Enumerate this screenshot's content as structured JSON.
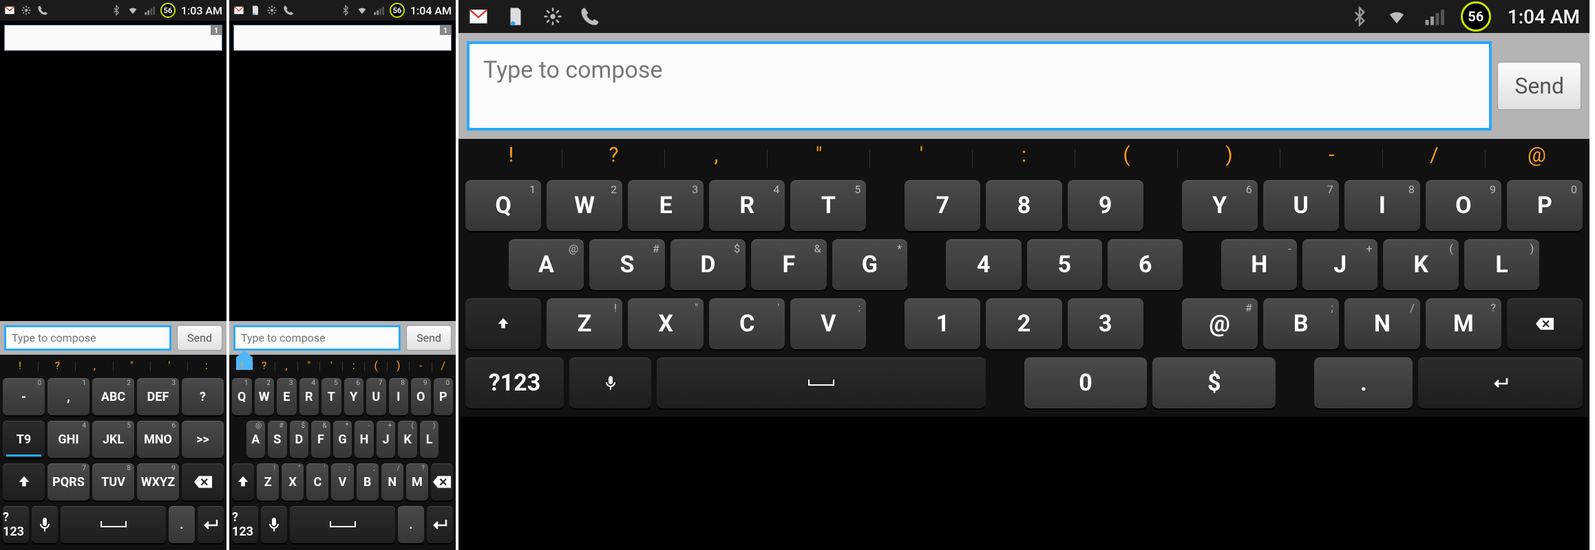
{
  "status": {
    "battery": "56",
    "time1": "1:03 AM",
    "time2": "1:04 AM",
    "time3": "1:04 AM"
  },
  "compose": {
    "placeholder": "Type to compose",
    "send": "Send",
    "recipient_badge": "1"
  },
  "hints_s1": [
    "!",
    "?",
    ",",
    "\"",
    "'",
    ":"
  ],
  "hints_s2": [
    "!",
    "?",
    ",",
    "\"",
    "'",
    ":",
    "(",
    ")",
    "-",
    "/"
  ],
  "hints_s3": [
    "!",
    "?",
    ",",
    "\"",
    "'",
    ":",
    "(",
    ")",
    "-",
    "/",
    "@"
  ],
  "t9": {
    "row1": [
      {
        "main": "-",
        "sup": "0"
      },
      {
        "main": ",",
        "sup": "1"
      },
      {
        "main": "ABC",
        "sup": "2"
      },
      {
        "main": "DEF",
        "sup": "3"
      },
      {
        "main": "?",
        "sup": ""
      }
    ],
    "row2": [
      {
        "main": "T9",
        "sup": "",
        "t9": true
      },
      {
        "main": "GHI",
        "sup": "4"
      },
      {
        "main": "JKL",
        "sup": "5"
      },
      {
        "main": "MNO",
        "sup": "6"
      },
      {
        "main": ">>",
        "sup": ""
      }
    ],
    "row3": [
      {
        "main": "shift"
      },
      {
        "main": "PQRS",
        "sup": "7"
      },
      {
        "main": "TUV",
        "sup": "8"
      },
      {
        "main": "WXYZ",
        "sup": "9"
      },
      {
        "main": "back"
      }
    ],
    "row4": [
      {
        "main": "?123"
      },
      {
        "main": "mic"
      },
      {
        "main": "space"
      },
      {
        "main": ".",
        "sup": ""
      },
      {
        "main": "enter"
      }
    ]
  },
  "qwerty_small": {
    "row1": [
      {
        "main": "Q",
        "sup": "1"
      },
      {
        "main": "W",
        "sup": "2"
      },
      {
        "main": "E",
        "sup": "3"
      },
      {
        "main": "R",
        "sup": "4"
      },
      {
        "main": "T",
        "sup": "5"
      },
      {
        "main": "Y",
        "sup": "6"
      },
      {
        "main": "U",
        "sup": "7"
      },
      {
        "main": "I",
        "sup": "8"
      },
      {
        "main": "O",
        "sup": "9"
      },
      {
        "main": "P",
        "sup": "0"
      }
    ],
    "row2": [
      {
        "main": "A",
        "sup": "@"
      },
      {
        "main": "S",
        "sup": "#"
      },
      {
        "main": "D",
        "sup": "$"
      },
      {
        "main": "F",
        "sup": "&"
      },
      {
        "main": "G",
        "sup": "*"
      },
      {
        "main": "H",
        "sup": "-"
      },
      {
        "main": "J",
        "sup": "+"
      },
      {
        "main": "K",
        "sup": "("
      },
      {
        "main": "L",
        "sup": ")"
      }
    ],
    "row3": [
      {
        "main": "shift"
      },
      {
        "main": "Z",
        "sup": "!"
      },
      {
        "main": "X",
        "sup": "\""
      },
      {
        "main": "C",
        "sup": "'"
      },
      {
        "main": "V",
        "sup": ":"
      },
      {
        "main": "B",
        "sup": ";"
      },
      {
        "main": "N",
        "sup": "/"
      },
      {
        "main": "M",
        "sup": "?"
      },
      {
        "main": "back"
      }
    ],
    "row4": [
      {
        "main": "?123"
      },
      {
        "main": "mic"
      },
      {
        "main": "space"
      },
      {
        "main": "."
      },
      {
        "main": "enter"
      }
    ]
  },
  "qwerty_wide": {
    "row1": {
      "left": [
        {
          "main": "Q",
          "sup": "1"
        },
        {
          "main": "W",
          "sup": "2"
        },
        {
          "main": "E",
          "sup": "3"
        },
        {
          "main": "R",
          "sup": "4"
        },
        {
          "main": "T",
          "sup": "5"
        }
      ],
      "mid": [
        {
          "main": "7"
        },
        {
          "main": "8"
        },
        {
          "main": "9"
        }
      ],
      "right": [
        {
          "main": "Y",
          "sup": "6"
        },
        {
          "main": "U",
          "sup": "7"
        },
        {
          "main": "I",
          "sup": "8"
        },
        {
          "main": "O",
          "sup": "9"
        },
        {
          "main": "P",
          "sup": "0"
        }
      ]
    },
    "row2": {
      "left": [
        {
          "main": "A",
          "sup": "@"
        },
        {
          "main": "S",
          "sup": "#"
        },
        {
          "main": "D",
          "sup": "$"
        },
        {
          "main": "F",
          "sup": "&"
        },
        {
          "main": "G",
          "sup": "*"
        }
      ],
      "mid": [
        {
          "main": "4"
        },
        {
          "main": "5"
        },
        {
          "main": "6"
        }
      ],
      "right": [
        {
          "main": "H",
          "sup": "-"
        },
        {
          "main": "J",
          "sup": "+"
        },
        {
          "main": "K",
          "sup": "("
        },
        {
          "main": "L",
          "sup": ")"
        }
      ]
    },
    "row3": {
      "left": [
        {
          "main": "shift"
        },
        {
          "main": "Z",
          "sup": "!"
        },
        {
          "main": "X",
          "sup": "\""
        },
        {
          "main": "C",
          "sup": "'"
        },
        {
          "main": "V",
          "sup": ":"
        }
      ],
      "mid": [
        {
          "main": "1"
        },
        {
          "main": "2"
        },
        {
          "main": "3"
        }
      ],
      "right": [
        {
          "main": "@",
          "sup": "#"
        },
        {
          "main": "B",
          "sup": ";"
        },
        {
          "main": "N",
          "sup": "/"
        },
        {
          "main": "M",
          "sup": "?"
        },
        {
          "main": "back"
        }
      ]
    },
    "row4": {
      "left": [
        {
          "main": "?123"
        },
        {
          "main": "mic"
        },
        {
          "main": "space"
        }
      ],
      "mid": [
        {
          "main": "0"
        },
        {
          "main": "$"
        }
      ],
      "right": [
        {
          "main": "."
        },
        {
          "main": "enter"
        }
      ]
    }
  }
}
